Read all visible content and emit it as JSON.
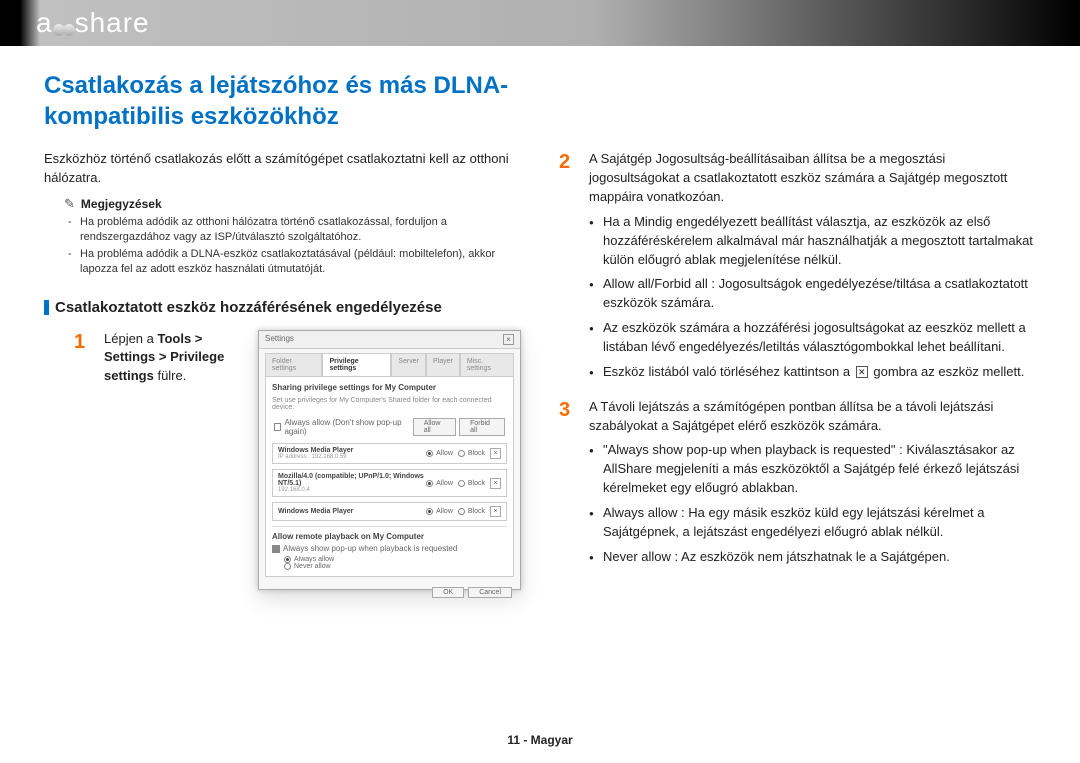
{
  "logo": {
    "text": "allshare"
  },
  "title": "Csatlakozás a lejátszóhoz és más DLNA-kompatibilis eszközökhöz",
  "intro": "Eszközhöz történő csatlakozás előtt a számítógépet csatlakoztatni kell az otthoni hálózatra.",
  "notes": {
    "heading": "Megjegyzések",
    "items": [
      "Ha probléma adódik az otthoni hálózatra történő csatlakozással, forduljon a rendszergazdához vagy az ISP/útválasztó szolgáltatóhoz.",
      "Ha probléma adódik a DLNA-eszköz csatlakoztatásával (például: mobiltelefon), akkor lapozza fel az adott eszköz használati útmutatóját."
    ]
  },
  "section_heading": "Csatlakoztatott eszköz hozzáférésének engedélyezése",
  "step1": {
    "num": "1",
    "pre": "Lépjen a ",
    "bold": "Tools > Settings > Privilege settings",
    "post": " fülre."
  },
  "step2": {
    "num": "2",
    "lead": "A Sajátgép Jogosultság-beállításaiban állítsa be a megosztási jogosultságokat a csatlakoztatott eszköz számára a Sajátgép megosztott mappáira vonatkozóan.",
    "bullets": [
      "Ha a Mindig engedélyezett beállítást választja, az eszközök az első hozzáféréskérelem alkalmával már használhatják a megosztott tartalmakat külön előugró ablak megjelenítése nélkül.",
      "Allow all/Forbid all : Jogosultságok engedélyezése/tiltása a csatlakoztatott eszközök számára.",
      "Az eszközök számára a hozzáférési jogosultságokat az eeszköz mellett a listában lévő engedélyezés/letiltás választógombokkal lehet beállítani."
    ],
    "bullet_x_pre": "Eszköz listából való törléséhez kattintson a ",
    "bullet_x_post": " gombra az eszköz mellett."
  },
  "step3": {
    "num": "3",
    "lead": "A Távoli lejátszás a számítógépen pontban állítsa be a távoli lejátszási szabályokat a Sajátgépet elérő eszközök számára.",
    "bullets": [
      "\"Always show pop-up when playback is requested\" : Kiválasztásakor az AllShare megjeleníti a más eszközöktől a Sajátgép felé érkező lejátszási kérelmeket egy előugró ablakban.",
      "Always allow : Ha egy másik eszköz küld egy lejátszási kérelmet a Sajátgépnek, a lejátszást engedélyezi előugró ablak nélkül.",
      "Never allow : Az eszközök nem játszhatnak le a Sajátgépen."
    ]
  },
  "dialog": {
    "title": "Settings",
    "tabs": [
      "Folder settings",
      "Privilege settings",
      "Server",
      "Player",
      "Misc. settings"
    ],
    "h1": "Sharing privilege settings for My Computer",
    "sub1": "Set use privileges for My Computer's Shared folder for each connected device.",
    "always_chk": "Always allow (Don't show pop-up again)",
    "allow_all": "Allow all",
    "forbid_all": "Forbid all",
    "devices": [
      {
        "name": "Windows Media Player",
        "sub": "IP address : 192.168.0.59",
        "allow": "Allow",
        "block": "Block"
      },
      {
        "name": "Mozilla/4.0 (compatible; UPnP/1.0; Windows NT/5.1)",
        "sub": "192.168.0.4",
        "allow": "Allow",
        "block": "Block"
      },
      {
        "name": "Windows Media Player",
        "sub": "",
        "allow": "Allow",
        "block": "Block"
      }
    ],
    "h2": "Allow remote playback on My Computer",
    "chk2": "Always show pop-up when playback is requested",
    "r_always": "Always allow",
    "r_never": "Never allow",
    "ok": "OK",
    "cancel": "Cancel"
  },
  "footer": "11 - Magyar"
}
